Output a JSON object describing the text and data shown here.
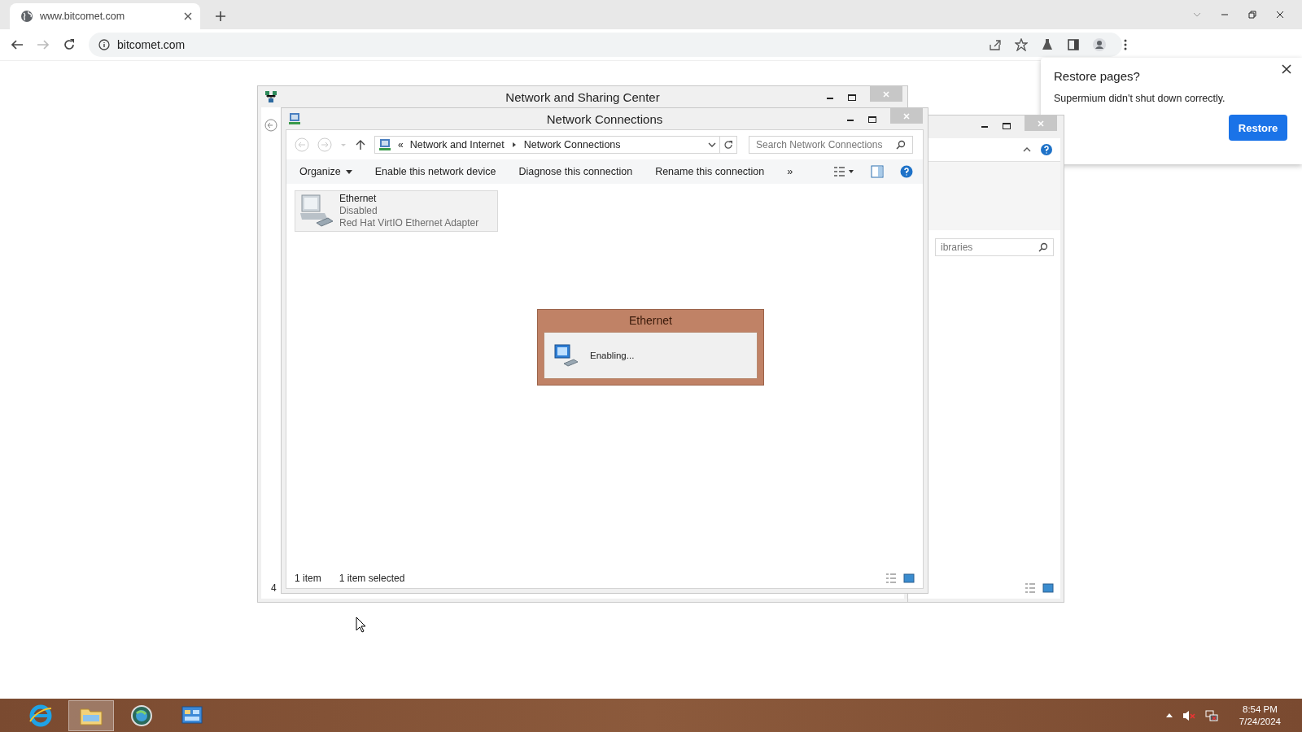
{
  "browser": {
    "tabs": [
      {
        "title": "www.bitcomet.com",
        "selected": true
      }
    ],
    "address": "bitcomet.com"
  },
  "restore_popup": {
    "title": "Restore pages?",
    "message": "Supermium didn't shut down correctly.",
    "button": "Restore"
  },
  "sharing_center_window": {
    "title": "Network and Sharing Center",
    "status_text": "4"
  },
  "libraries_window": {
    "search_placeholder": "ibraries"
  },
  "network_connections_window": {
    "title": "Network Connections",
    "overflow_glyph": "«",
    "breadcrumb": [
      "Network and Internet",
      "Network Connections"
    ],
    "search_placeholder": "Search Network Connections",
    "commands": [
      {
        "label": "Organize",
        "kind": "menu"
      },
      {
        "label": "Enable this network device",
        "kind": "command"
      },
      {
        "label": "Diagnose this connection",
        "kind": "command"
      },
      {
        "label": "Rename this connection",
        "kind": "command"
      }
    ],
    "more": "»",
    "items": [
      {
        "name": "Ethernet",
        "status": "Disabled",
        "device": "Red Hat VirtIO Ethernet Adapter",
        "selected": true
      }
    ],
    "status_bar": {
      "count": "1 item",
      "selection": "1 item selected"
    }
  },
  "progress_dialog": {
    "title": "Ethernet",
    "message": "Enabling..."
  },
  "taskbar": {
    "apps": [
      {
        "kind": "browser",
        "selected": false
      },
      {
        "kind": "folder",
        "selected": true
      },
      {
        "kind": "globe",
        "selected": false
      },
      {
        "kind": "control-panel",
        "selected": false
      }
    ],
    "time": "8:54 PM",
    "date": "7/24/2024"
  }
}
